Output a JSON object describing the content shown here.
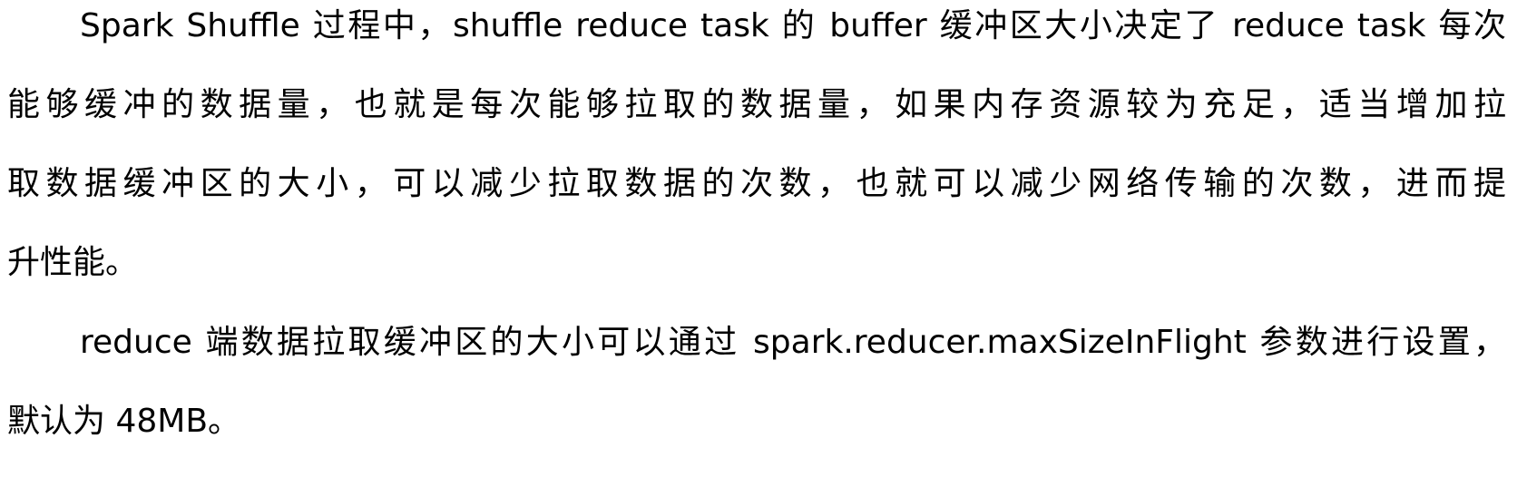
{
  "document": {
    "paragraphs": [
      {
        "lines": [
          "Spark Shuffle 过程中，shuffle reduce task 的 buffer 缓冲区大小决定了 reduce task 每次",
          "能够缓冲的数据量，也就是每次能够拉取的数据量，如果内存资源较为充足，适当增加拉",
          "取数据缓冲区的大小，可以减少拉取数据的次数，也就可以减少网络传输的次数，进而提",
          "升性能。"
        ]
      },
      {
        "lines": [
          "reduce 端数据拉取缓冲区的大小可以通过 spark.reducer.maxSizeInFlight 参数进行设置，",
          "默认为 48MB。"
        ]
      }
    ]
  }
}
